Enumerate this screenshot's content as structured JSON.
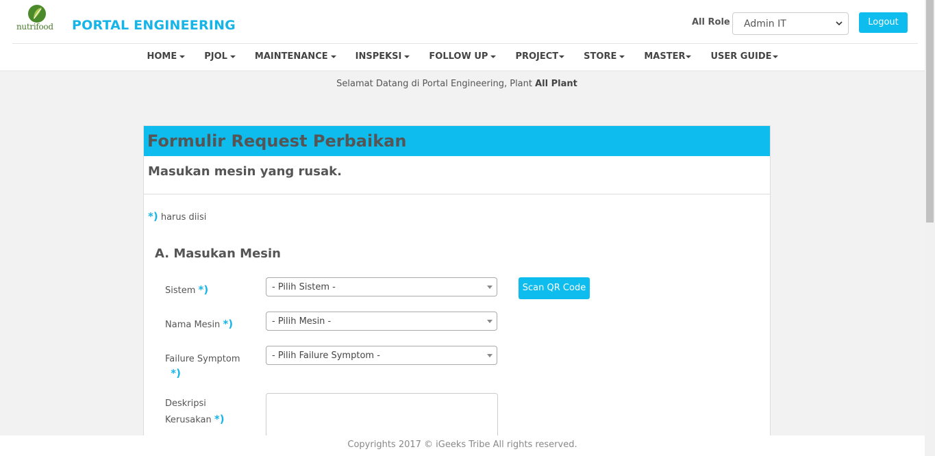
{
  "brand": {
    "logo_text": "nutrifood",
    "title": "PORTAL ENGINEERING"
  },
  "role": {
    "label": "All Role",
    "selected": "Admin IT"
  },
  "logout_label": "Logout",
  "nav": [
    {
      "label": "HOME"
    },
    {
      "label": "PJOL"
    },
    {
      "label": "MAINTENANCE"
    },
    {
      "label": "INSPEKSI"
    },
    {
      "label": "FOLLOW UP"
    },
    {
      "label": "PROJECT"
    },
    {
      "label": "STORE"
    },
    {
      "label": "MASTER"
    },
    {
      "label": "USER GUIDE"
    }
  ],
  "welcome": {
    "text": "Selamat Datang di Portal Engineering, Plant ",
    "plant": "All Plant"
  },
  "form": {
    "title": "Formulir Request Perbaikan",
    "subtitle": "Masukan mesin yang rusak.",
    "required_mark": "*)",
    "required_note": "harus diisi",
    "section_title": "A. Masukan Mesin",
    "fields": {
      "sistem": {
        "label": "Sistem",
        "placeholder": "- Pilih Sistem -"
      },
      "mesin": {
        "label": "Nama Mesin",
        "placeholder": "- Pilih Mesin -"
      },
      "symptom": {
        "label": "Failure Symptom",
        "placeholder": "- Pilih Failure Symptom -"
      },
      "deskripsi": {
        "label_line1": "Deskripsi",
        "label_line2": "Kerusakan"
      }
    },
    "scan_button": "Scan QR Code"
  },
  "footer": "Copyrights 2017 © iGeeks Tribe All rights reserved.",
  "colors": {
    "accent": "#0fbcee",
    "brand": "#17b4e8",
    "logo_green": "#4a7a2c"
  }
}
